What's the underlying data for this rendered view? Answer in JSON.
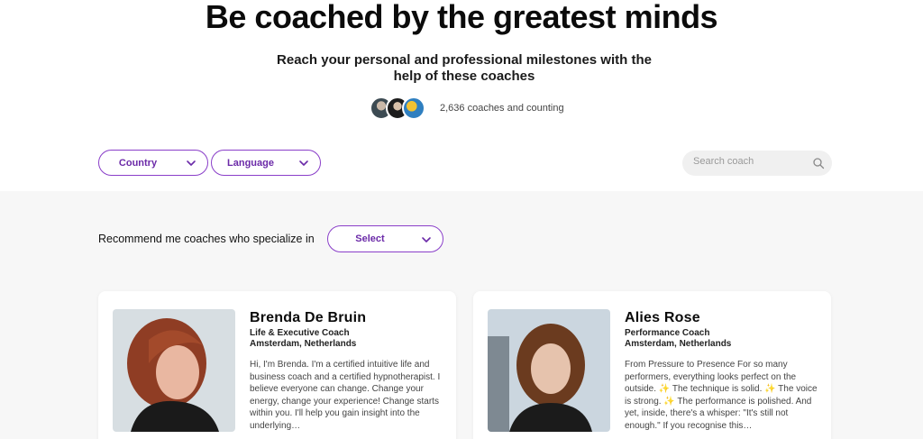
{
  "hero": {
    "title": "Be coached by the greatest minds",
    "subtitle": "Reach your personal and professional milestones with the help of these coaches",
    "count_text": "2,636 coaches and counting"
  },
  "filters": {
    "country_label": "Country",
    "language_label": "Language",
    "search_placeholder": "Search coach"
  },
  "recommend": {
    "label": "Recommend me coaches who specialize in",
    "select_label": "Select"
  },
  "coaches": [
    {
      "name": "Brenda De Bruin",
      "role": "Life & Executive Coach",
      "location": "Amsterdam, Netherlands",
      "bio": "Hi, I'm Brenda. I'm a certified intuitive life and business coach and a certified hypnotherapist. I believe everyone can change. Change your energy, change your experience! Change starts within you. I'll help you gain insight into the underlying…"
    },
    {
      "name": "Alies Rose",
      "role": "Performance Coach",
      "location": "Amsterdam, Netherlands",
      "bio": "From Pressure to Presence For so many performers, everything looks perfect on the outside. ✨ The technique is solid. ✨ The voice is strong. ✨ The performance is polished. And yet, inside, there's a whisper: \"It's still not enough.\" If you recognise this…"
    }
  ],
  "colors": {
    "accent": "#8a3fc9",
    "accent_text": "#6b2aa8",
    "section_bg": "#f7f7f7"
  },
  "icons": [
    "chevron-down-icon",
    "search-icon"
  ]
}
